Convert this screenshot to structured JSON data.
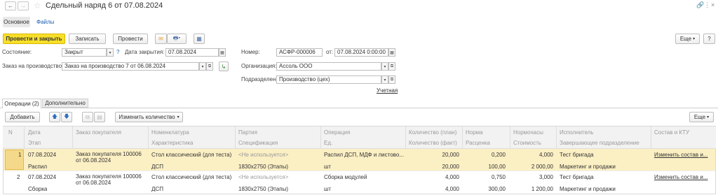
{
  "window": {
    "title": "Сдельный наряд 6 от 07.08.2024"
  },
  "tabs_top": {
    "main": "Основное",
    "files": "Файлы"
  },
  "toolbar": {
    "post_close": "Провести и закрыть",
    "save": "Записать",
    "post": "Провести",
    "more": "Еще",
    "help": "?"
  },
  "form": {
    "state_label": "Состояние:",
    "state_value": "Закрыт",
    "help_q": "?",
    "close_date_label": "Дата закрытия:",
    "close_date_value": "07.08.2024",
    "number_label": "Номер:",
    "number_value": "АСФР-000006",
    "from_label": "от:",
    "from_value": "07.08.2024  0:00:00",
    "order_label": "Заказ на производство:",
    "order_value": "Заказ на производство 7 от 06.08.2024",
    "org_label": "Организация:",
    "org_value": "Ассоль ООО",
    "dept_label": "Подразделение:",
    "dept_value": "Производство (цех)",
    "accounting_link": "Учетная"
  },
  "tabs_section": {
    "ops": "Операции (2)",
    "extra": "Дополнительно"
  },
  "ops_toolbar": {
    "add": "Добавить",
    "change_qty": "Изменить количество",
    "more": "Еще"
  },
  "table": {
    "headers1": [
      "N",
      "Дата",
      "Заказ покупателя",
      "Номенклатура",
      "Партия",
      "Операция",
      "Количество (план)",
      "Норма",
      "Нормочасы",
      "Исполнитель",
      "Состав и КТУ"
    ],
    "headers2": [
      "Этап",
      "Характеристика",
      "Спецификация",
      "Ед.",
      "Количество (факт)",
      "Расценка",
      "Стоимость",
      "Завершающее подразделение"
    ],
    "rows": [
      {
        "n": "1",
        "date": "07.08.2024",
        "stage": "Распил",
        "customer_order": "Заказ покупателя 100006 от 06.08.2024",
        "nomenclature": "Стол классический (для теста)",
        "characteristic": "ДСП",
        "batch": "<Не используется>",
        "spec": "1830х2750 (Этапы)",
        "operation": "Распил ДСП, МДФ и листово...",
        "unit": "шт",
        "qty_plan": "20,000",
        "qty_fact": "20,000",
        "norm": "0,200",
        "rate": "100,00",
        "norm_hours": "4,000",
        "cost": "2 000,00",
        "executor": "Тест бригада",
        "final_dept": "Маркетинг и продажи",
        "composition": "Изменить состав и..."
      },
      {
        "n": "2",
        "date": "07.08.2024",
        "stage": "Сборка",
        "customer_order": "Заказ покупателя 100006 от 06.08.2024",
        "nomenclature": "Стол классический (для теста)",
        "characteristic": "ДСП",
        "batch": "<Не используется>",
        "spec": "1830х2750 (Этапы)",
        "operation": "Сборка модулей",
        "unit": "шт",
        "qty_plan": "4,000",
        "qty_fact": "4,000",
        "norm": "0,750",
        "rate": "300,00",
        "norm_hours": "3,000",
        "cost": "1 200,00",
        "executor": "Тест бригада",
        "final_dept": "Маркетинг и продажи",
        "composition": "Изменить состав и..."
      }
    ]
  },
  "colors": {
    "accent_yellow": "#f8df2a",
    "selected_row": "#fbefc4",
    "selected_cell": "#f5d98a"
  }
}
